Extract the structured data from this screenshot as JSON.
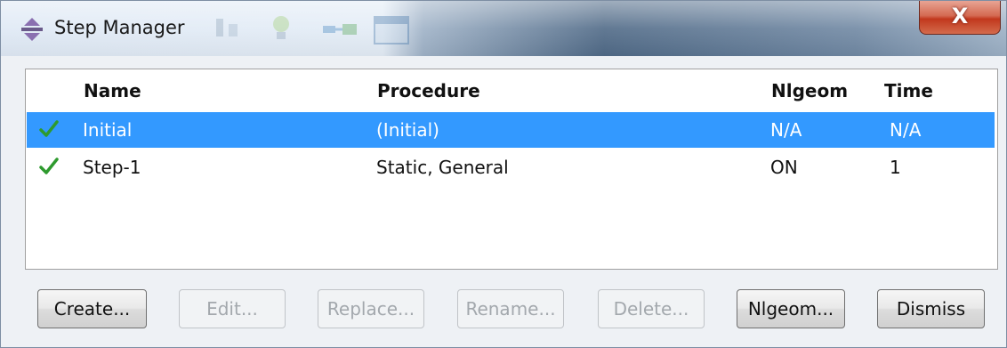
{
  "window": {
    "title": "Step Manager",
    "close_label": "X"
  },
  "table": {
    "columns": [
      "Name",
      "Procedure",
      "Nlgeom",
      "Time"
    ],
    "rows": [
      {
        "status": "check-icon",
        "name": "Initial",
        "procedure": "(Initial)",
        "nlgeom": "N/A",
        "time": "N/A",
        "selected": true
      },
      {
        "status": "check-icon",
        "name": "Step-1",
        "procedure": "Static, General",
        "nlgeom": "ON",
        "time": "1",
        "selected": false
      }
    ]
  },
  "buttons": {
    "create": "Create...",
    "edit": "Edit...",
    "replace": "Replace...",
    "rename": "Rename...",
    "delete": "Delete...",
    "nlgeom": "Nlgeom...",
    "dismiss": "Dismiss"
  },
  "colors": {
    "selection": "#3399ff",
    "check": "#2e9a2e",
    "close": "#c2381d"
  }
}
